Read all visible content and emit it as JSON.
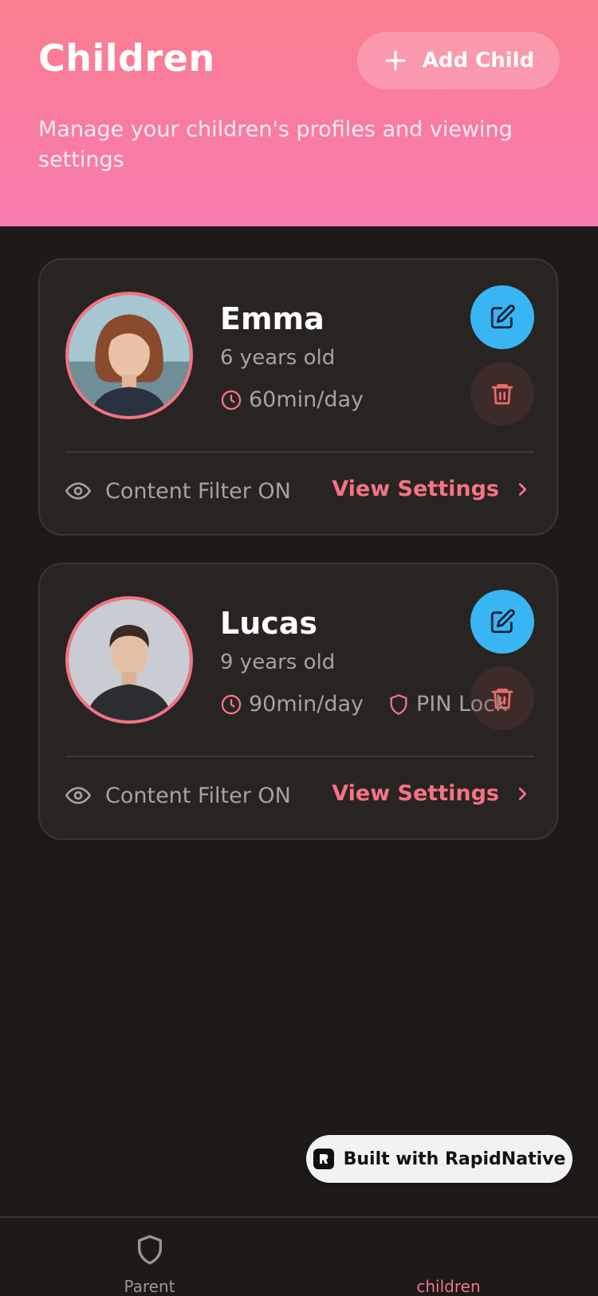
{
  "header": {
    "title": "Children",
    "add_button_label": "Add Child",
    "subtitle": "Manage your children's profiles and viewing settings"
  },
  "children": [
    {
      "name": "Emma",
      "age": "6 years old",
      "screen_time": "60min/day",
      "filter_label": "Content Filter ON",
      "view_label": "View Settings"
    },
    {
      "name": "Lucas",
      "age": "9 years old",
      "screen_time": "90min/day",
      "pin_label": "PIN Lock",
      "filter_label": "Content Filter ON",
      "view_label": "View Settings"
    }
  ],
  "badge": {
    "label": "Built with RapidNative"
  },
  "tabs": [
    {
      "label": "Parent",
      "icon": "shield-icon",
      "active": false
    },
    {
      "label": "children",
      "active": true
    }
  ],
  "colors": {
    "accent": "#f47384",
    "edit": "#38b6f4",
    "background": "#1d1a18",
    "card": "#282422",
    "header_top": "#fa7e8e",
    "header_bottom": "#f67bb0"
  }
}
